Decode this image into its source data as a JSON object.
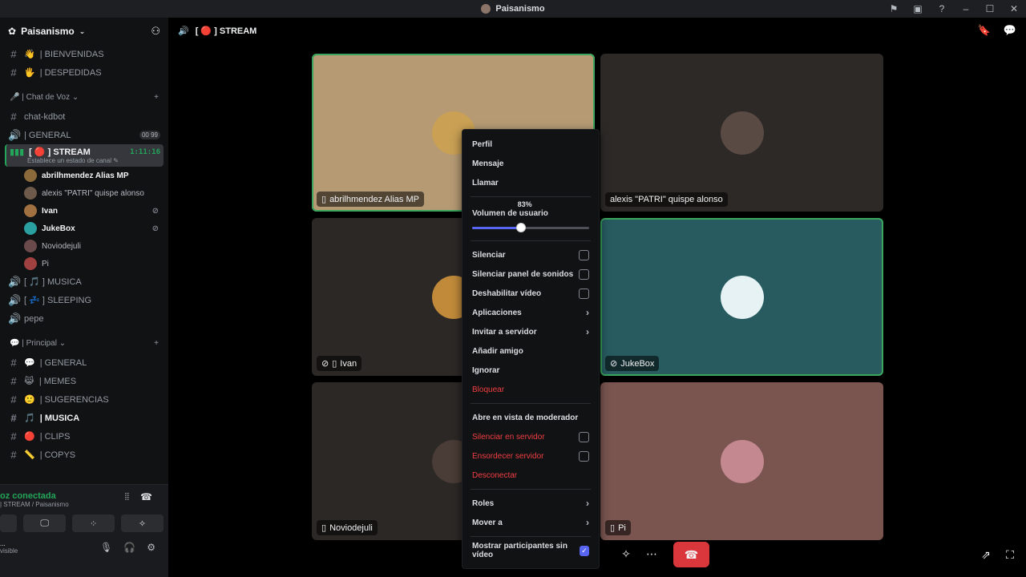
{
  "window": {
    "title": "Paisanismo"
  },
  "server": {
    "name": "Paisanismo"
  },
  "sidebar": {
    "top_channels": [
      {
        "icon": "hash",
        "emoji": "👋",
        "label": "| BIENVENIDAS"
      },
      {
        "icon": "hash",
        "emoji": "🖐",
        "label": "| DESPEDIDAS"
      }
    ],
    "voice_category": "| Chat de Voz",
    "voice_channels_pre": [
      {
        "label": "chat-kdbot",
        "icon": "hash"
      },
      {
        "label": "| GENERAL",
        "icon": "speaker",
        "badges": [
          "00",
          "99"
        ]
      }
    ],
    "stream_channel": {
      "label": "[ 🔴 ] STREAM",
      "time": "1:11:16",
      "status": "Establece un estado de canal"
    },
    "members": [
      {
        "name": "abrilhmendez Alias MP",
        "bright": true
      },
      {
        "name": "alexis \"PATRI\" quispe alonso",
        "bright": false
      },
      {
        "name": "Ivan",
        "bright": true
      },
      {
        "name": "JukeBox",
        "bright": true
      },
      {
        "name": "Noviodejuli",
        "bright": false
      },
      {
        "name": "Pi",
        "bright": false
      }
    ],
    "voice_channels_post": [
      {
        "label": "[ 🎵 ] MUSICA"
      },
      {
        "label": "[ 💤 ] SLEEPING"
      },
      {
        "label": "pepe"
      }
    ],
    "principal_category": "| Principal",
    "principal_channels": [
      {
        "emoji": "💬",
        "label": "| GENERAL",
        "bold": false
      },
      {
        "emoji": "😹",
        "label": "| MEMES",
        "bold": false
      },
      {
        "emoji": "🙂",
        "label": "| SUGERENCIAS",
        "bold": false
      },
      {
        "emoji": "🎵",
        "label": "| MUSICA",
        "bold": true
      },
      {
        "emoji": "🔴",
        "label": "| CLIPS",
        "bold": false
      },
      {
        "emoji": "📏",
        "label": "| COPYS",
        "bold": false
      }
    ]
  },
  "voice_panel": {
    "connected": "oz conectada",
    "location": "| STREAM / Paisanismo",
    "user_status": "visible"
  },
  "stage": {
    "title": "[ 🔴 ] STREAM",
    "tiles": [
      {
        "label": "abrilhmendez Alias MP",
        "bg": "#b59a74"
      },
      {
        "label": "alexis \"PATRI\" quispe alonso",
        "bg": "#2c2927"
      },
      {
        "label": "Ivan",
        "bg": "#2c2826"
      },
      {
        "label": "JukeBox",
        "bg": "#275b60"
      },
      {
        "label": "Noviodejuli",
        "bg": "#2c2826"
      },
      {
        "label": "Pi",
        "bg": "#7a5550"
      }
    ]
  },
  "context_menu": {
    "items_top": [
      "Perfil",
      "Mensaje",
      "Llamar"
    ],
    "volume_label": "Volumen de usuario",
    "volume_percent": 83,
    "volume_tip": "83%",
    "checks": [
      {
        "label": "Silenciar",
        "checked": false
      },
      {
        "label": "Silenciar panel de sonidos",
        "checked": false
      },
      {
        "label": "Deshabilitar vídeo",
        "checked": false
      }
    ],
    "submenus": [
      "Aplicaciones",
      "Invitar a servidor"
    ],
    "actions": [
      "Añadir amigo",
      "Ignorar"
    ],
    "block": "Bloquear",
    "moderator_view": "Abre en vista de moderador",
    "mod_checks": [
      {
        "label": "Silenciar en servidor",
        "checked": false
      },
      {
        "label": "Ensordecer servidor",
        "checked": false
      }
    ],
    "disconnect": "Desconectar",
    "submenus2": [
      "Roles",
      "Mover a"
    ],
    "show_participants": "Mostrar participantes sin vídeo",
    "show_participants_checked": true
  }
}
